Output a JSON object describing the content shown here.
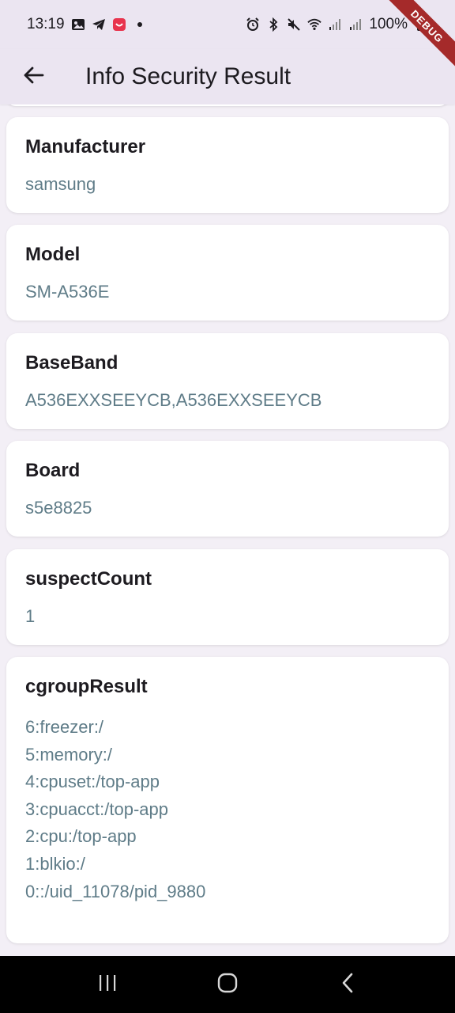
{
  "status_bar": {
    "time": "13:19",
    "battery": "100%",
    "left_icons": [
      "gallery-icon",
      "telegram-icon",
      "app-notification-icon",
      "dot-icon"
    ],
    "right_icons": [
      "alarm-icon",
      "bluetooth-icon",
      "mute-icon",
      "wifi-icon",
      "signal-icon",
      "signal-icon",
      "battery-icon"
    ]
  },
  "app_bar": {
    "title": "Info Security Result",
    "back_icon": "back-arrow-icon",
    "background": "#ebe5f1"
  },
  "debug_banner": "DEBUG",
  "cards": [
    {
      "title": "Manufacturer",
      "value": "samsung"
    },
    {
      "title": "Model",
      "value": "SM-A536E"
    },
    {
      "title": "BaseBand",
      "value": "A536EXXSEEYCB,A536EXXSEEYCB"
    },
    {
      "title": "Board",
      "value": "s5e8825"
    },
    {
      "title": "suspectCount",
      "value": "1"
    }
  ],
  "cgroup": {
    "title": "cgroupResult",
    "lines": [
      "6:freezer:/",
      "5:memory:/",
      "4:cpuset:/top-app",
      "3:cpuacct:/top-app",
      "2:cpu:/top-app",
      "1:blkio:/",
      "0::/uid_11078/pid_9880"
    ]
  },
  "colors": {
    "value_text": "#5f7c88",
    "page_background": "#f3eff6",
    "card_background": "#ffffff",
    "debug_ribbon": "#a52a2a"
  },
  "nav_bar": {
    "buttons": [
      "recent-apps-icon",
      "home-icon",
      "back-icon"
    ]
  }
}
